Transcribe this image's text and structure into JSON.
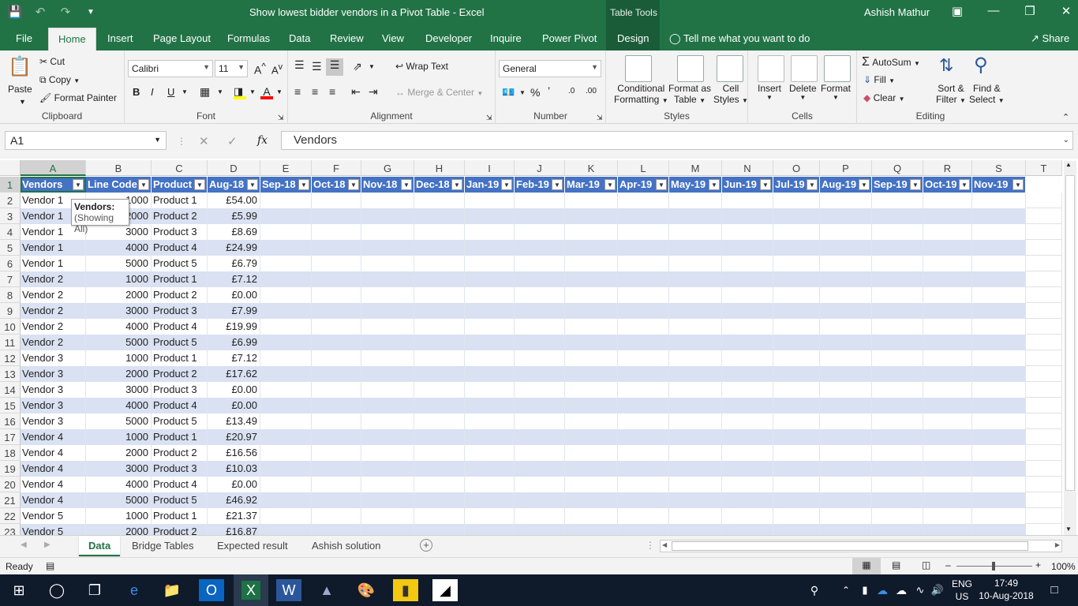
{
  "window": {
    "title": "Show lowest bidder vendors in a Pivot Table  -  Excel",
    "table_tools": "Table Tools",
    "user": "Ashish Mathur"
  },
  "tabs": [
    "File",
    "Home",
    "Insert",
    "Page Layout",
    "Formulas",
    "Data",
    "Review",
    "View",
    "Developer",
    "Inquire",
    "Power Pivot",
    "Design"
  ],
  "tell_me": "Tell me what you want to do",
  "share": "Share",
  "ribbon": {
    "clipboard": {
      "label": "Clipboard",
      "paste": "Paste",
      "cut": "Cut",
      "copy": "Copy",
      "format_painter": "Format Painter"
    },
    "font": {
      "label": "Font",
      "name": "Calibri",
      "size": "11"
    },
    "alignment": {
      "label": "Alignment",
      "wrap": "Wrap Text",
      "merge": "Merge & Center"
    },
    "number": {
      "label": "Number",
      "format": "General"
    },
    "styles": {
      "label": "Styles",
      "cond1": "Conditional",
      "cond2": "Formatting",
      "fat1": "Format as",
      "fat2": "Table",
      "cs1": "Cell",
      "cs2": "Styles"
    },
    "cells": {
      "label": "Cells",
      "insert": "Insert",
      "delete": "Delete",
      "format": "Format"
    },
    "editing": {
      "label": "Editing",
      "autosum": "AutoSum",
      "fill": "Fill",
      "clear": "Clear",
      "sort1": "Sort &",
      "sort2": "Filter",
      "find1": "Find &",
      "find2": "Select"
    }
  },
  "formula": {
    "namebox": "A1",
    "content": "Vendors"
  },
  "columns": [
    "A",
    "B",
    "C",
    "D",
    "E",
    "F",
    "G",
    "H",
    "I",
    "J",
    "K",
    "L",
    "M",
    "N",
    "O",
    "P",
    "Q",
    "R",
    "S",
    "T"
  ],
  "headers": [
    "Vendors",
    "Line Code",
    "Product",
    "Aug-18",
    "Sep-18",
    "Oct-18",
    "Nov-18",
    "Dec-18",
    "Jan-19",
    "Feb-19",
    "Mar-19",
    "Apr-19",
    "May-19",
    "Jun-19",
    "Jul-19",
    "Aug-19",
    "Sep-19",
    "Oct-19",
    "Nov-19"
  ],
  "rows": [
    [
      "Vendor 1",
      "1000",
      "Product 1",
      "£54.00"
    ],
    [
      "Vendor 1",
      "2000",
      "Product 2",
      "£5.99"
    ],
    [
      "Vendor 1",
      "3000",
      "Product 3",
      "£8.69"
    ],
    [
      "Vendor 1",
      "4000",
      "Product 4",
      "£24.99"
    ],
    [
      "Vendor 1",
      "5000",
      "Product 5",
      "£6.79"
    ],
    [
      "Vendor 2",
      "1000",
      "Product 1",
      "£7.12"
    ],
    [
      "Vendor 2",
      "2000",
      "Product 2",
      "£0.00"
    ],
    [
      "Vendor 2",
      "3000",
      "Product 3",
      "£7.99"
    ],
    [
      "Vendor 2",
      "4000",
      "Product 4",
      "£19.99"
    ],
    [
      "Vendor 2",
      "5000",
      "Product 5",
      "£6.99"
    ],
    [
      "Vendor 3",
      "1000",
      "Product 1",
      "£7.12"
    ],
    [
      "Vendor 3",
      "2000",
      "Product 2",
      "£17.62"
    ],
    [
      "Vendor 3",
      "3000",
      "Product 3",
      "£0.00"
    ],
    [
      "Vendor 3",
      "4000",
      "Product 4",
      "£0.00"
    ],
    [
      "Vendor 3",
      "5000",
      "Product 5",
      "£13.49"
    ],
    [
      "Vendor 4",
      "1000",
      "Product 1",
      "£20.97"
    ],
    [
      "Vendor 4",
      "2000",
      "Product 2",
      "£16.56"
    ],
    [
      "Vendor 4",
      "3000",
      "Product 3",
      "£10.03"
    ],
    [
      "Vendor 4",
      "4000",
      "Product 4",
      "£0.00"
    ],
    [
      "Vendor 4",
      "5000",
      "Product 5",
      "£46.92"
    ],
    [
      "Vendor 5",
      "1000",
      "Product 1",
      "£21.37"
    ],
    [
      "Vendor 5",
      "2000",
      "Product 2",
      "£16.87"
    ]
  ],
  "tooltip": {
    "title": "Vendors:",
    "sub": "(Showing All)"
  },
  "sheets": [
    "Data",
    "Bridge Tables",
    "Expected result",
    "Ashish solution"
  ],
  "status": {
    "ready": "Ready",
    "zoom": "100%"
  },
  "taskbar": {
    "lang1": "ENG",
    "lang2": "US",
    "time": "17:49",
    "date": "10-Aug-2018"
  },
  "colors": {
    "excel_green": "#217346",
    "table_header": "#4472c4",
    "band": "#d9e1f2"
  }
}
